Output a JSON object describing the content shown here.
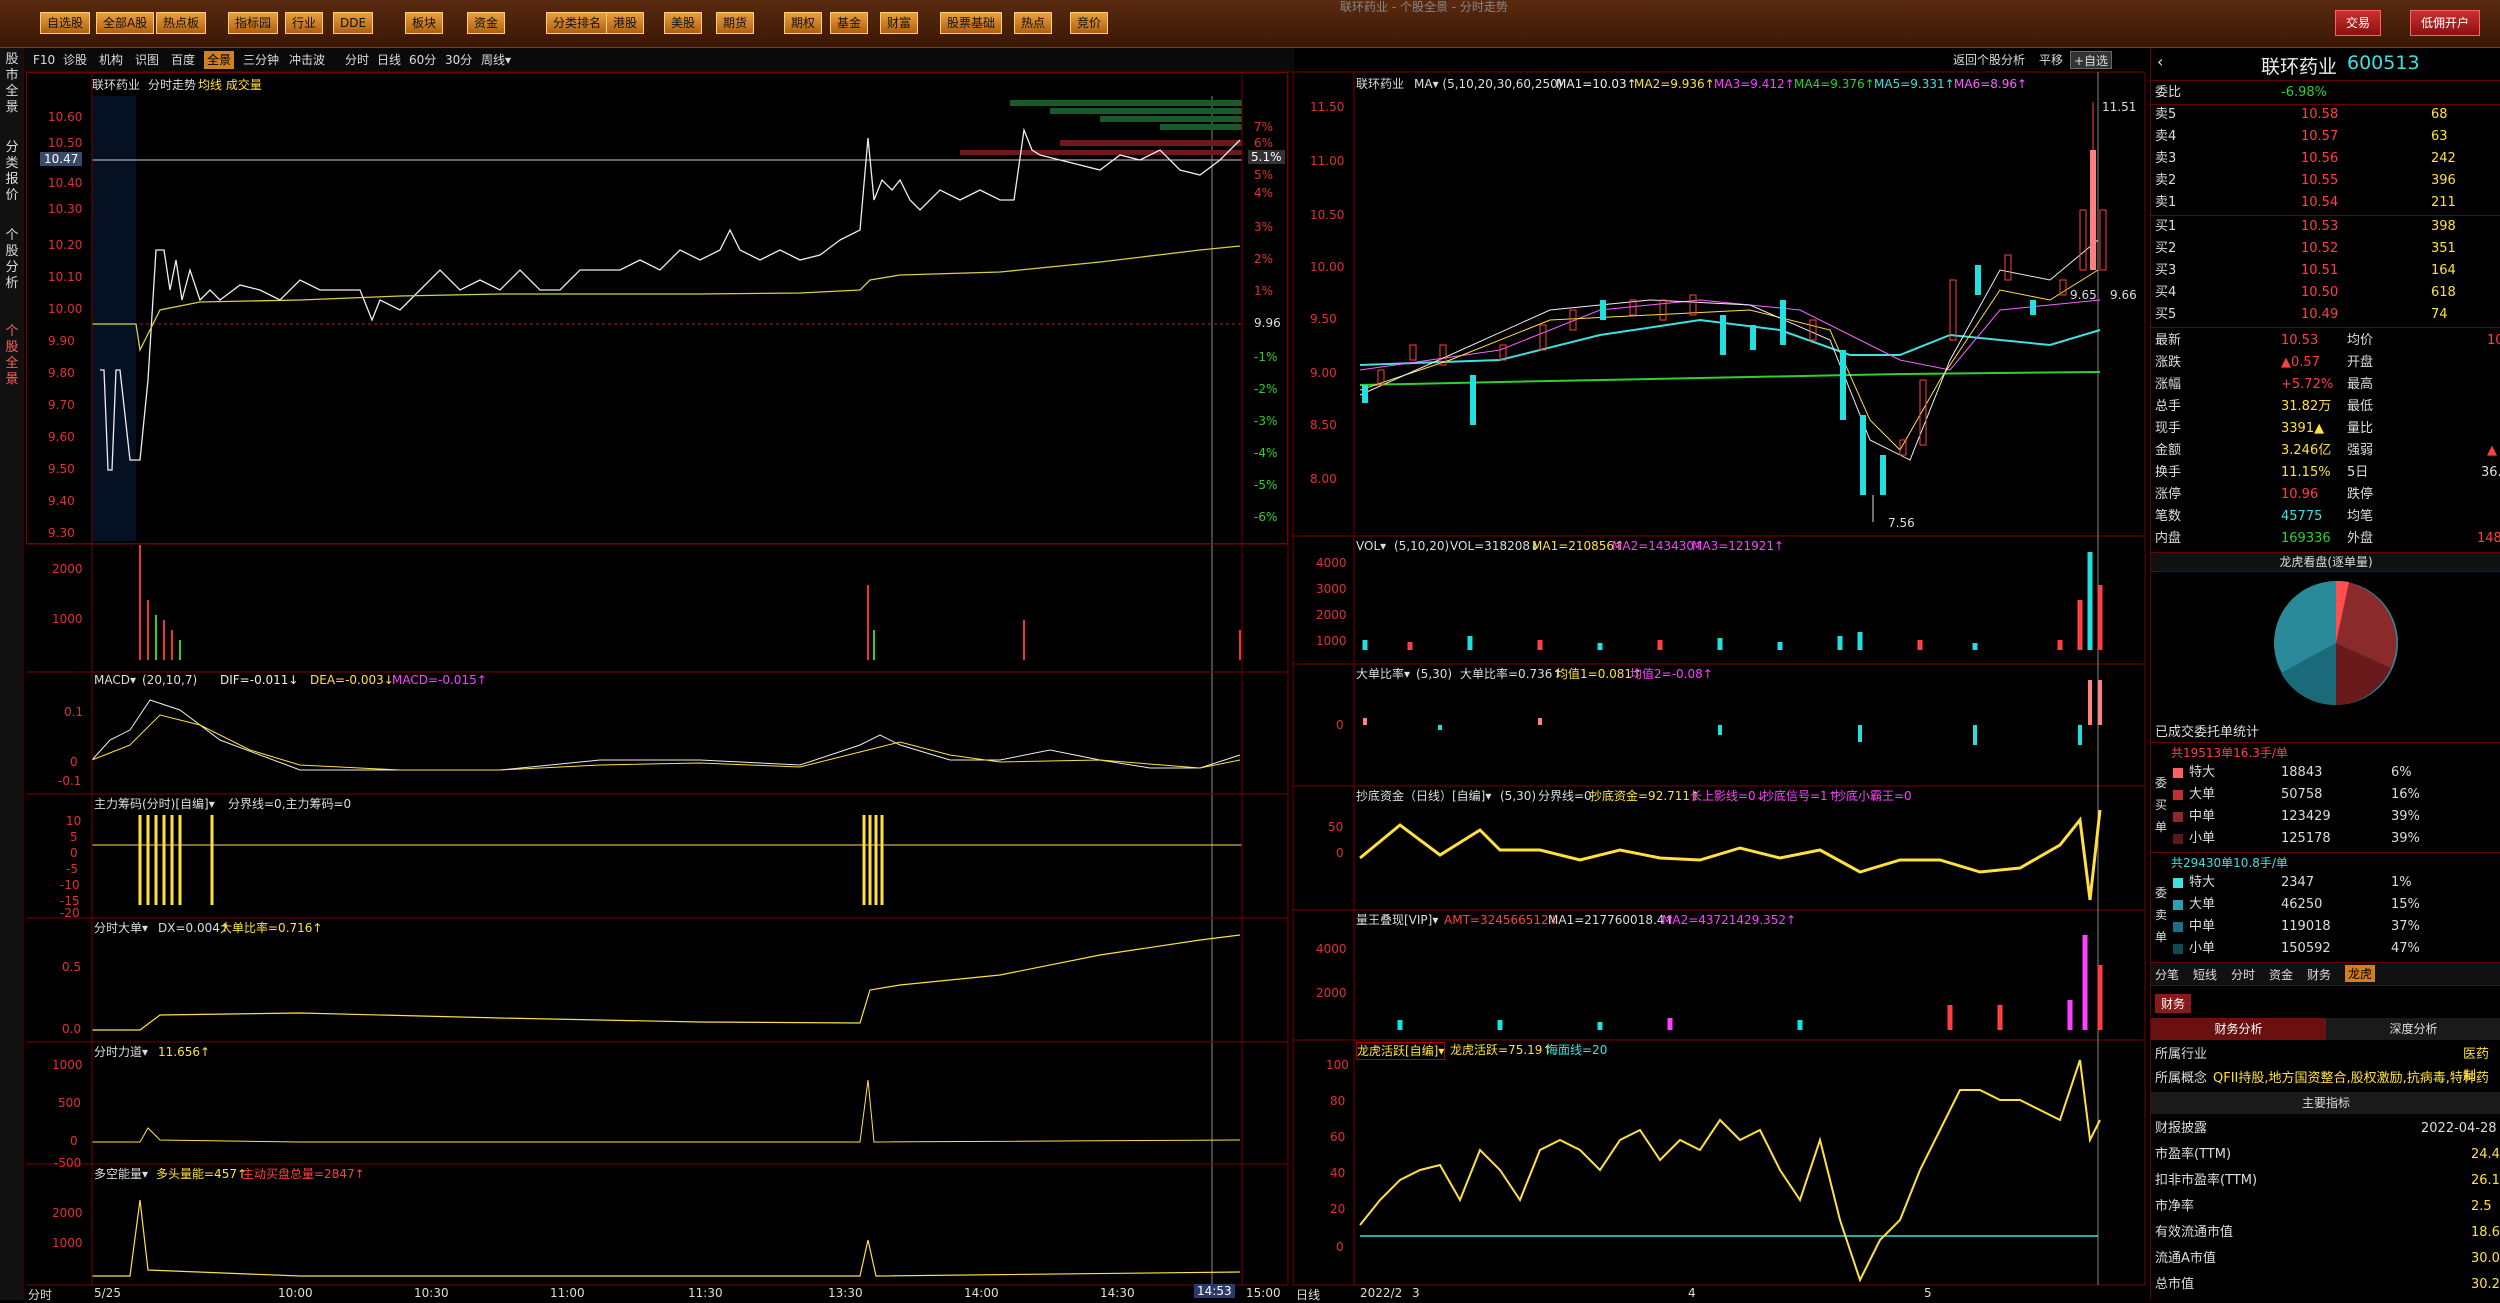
{
  "topbar": {
    "buttons": [
      "自选股",
      "全部A股",
      "热点板",
      "指标园",
      "行业",
      "DDE",
      "板块",
      "资金",
      "分类排名",
      "港股",
      "美股",
      "期货",
      "期权",
      "基金",
      "财富",
      "股票基础",
      "热点",
      "竞价"
    ],
    "title": "联环药业 - 个股全景 - 分时走势",
    "right_buttons": [
      "交易",
      "低佣开户"
    ]
  },
  "leftnav": {
    "tabs": [
      "股市全景",
      "分类报价",
      "个股分析",
      "个股全景"
    ]
  },
  "subtabs": {
    "items": [
      "F10",
      "诊股",
      "机构",
      "识图",
      "百度",
      "全景",
      "三分钟",
      "冲击波",
      "分时",
      "日线",
      "60分",
      "30分",
      "周线▾"
    ],
    "right": [
      "返回个股分析",
      "平移",
      "+自选"
    ]
  },
  "left": {
    "title": {
      "name": "联环药业",
      "mode": "分时走势",
      "indicator": "均线 成交量"
    },
    "price_axis": [
      "10.60",
      "10.50",
      "10.40",
      "10.30",
      "10.20",
      "10.10",
      "10.00",
      "9.90",
      "9.80",
      "9.70",
      "9.60",
      "9.50",
      "9.40",
      "9.30"
    ],
    "current_price": "10.47",
    "pct_axis": [
      "7%",
      "6%",
      "5%",
      "4%",
      "3%",
      "2%",
      "1%",
      "9.96",
      "-1%",
      "-2%",
      "-3%",
      "-4%",
      "-5%",
      "-6%"
    ],
    "current_pct": "5.1%",
    "vol_axis": [
      "2000",
      "1000"
    ],
    "macd": {
      "label": "MACD▾",
      "params": "(20,10,7)",
      "dif": "DIF=-0.011↓",
      "dea": "DEA=-0.003↓",
      "macd": "MACD=-0.015↑",
      "axis": [
        "0.1",
        "0",
        "-0.1"
      ]
    },
    "zlcm": {
      "label": "主力筹码(分时)[自编]▾",
      "text": "分界线=0,主力筹码=0",
      "axis": [
        "10",
        "5",
        "0",
        "-5",
        "-10",
        "-15",
        "-20"
      ]
    },
    "fsdd": {
      "label": "分时大单▾",
      "text": "DX=0.004↑",
      "text2": "大单比率=0.716↑",
      "axis": [
        "0.5",
        "0.0"
      ]
    },
    "fsld": {
      "label": "分时力道▾",
      "text": "11.656↑",
      "axis": [
        "1000",
        "500",
        "0",
        "-500"
      ]
    },
    "dknl": {
      "label": "多空能量▾",
      "text": "多头量能=457↑",
      "text2": "主动买盘总量=2847↑",
      "axis": [
        "2000",
        "1000"
      ]
    },
    "time_axis": [
      "5/25",
      "10:00",
      "10:30",
      "11:00",
      "11:30",
      "13:30",
      "14:00",
      "14:30",
      "15:00"
    ],
    "time_cursor": "14:53",
    "bottom_label": "分时"
  },
  "mid": {
    "title": {
      "name": "联环药业",
      "ma": "MA▾ (5,10,20,30,60,250)",
      "ma1": "MA1=10.03↑",
      "ma2": "MA2=9.936↑",
      "ma3": "MA3=9.412↑",
      "ma4": "MA4=9.376↑",
      "ma5": "MA5=9.331↑",
      "ma6": "MA6=8.96↑"
    },
    "price_axis": [
      "11.50",
      "11.00",
      "10.50",
      "10.00",
      "9.50",
      "9.00",
      "8.50",
      "8.00"
    ],
    "labels": {
      "high": "11.51",
      "low": "7.56",
      "close_l": "9.65",
      "close_r": "9.66"
    },
    "vol": {
      "label": "VOL▾",
      "params": "(5,10,20)",
      "vol": "VOL=318208↓",
      "ma1": "MA1=210856↑",
      "ma2": "MA2=143430↑",
      "ma3": "MA3=121921↑",
      "axis": [
        "4000",
        "3000",
        "2000",
        "1000"
      ]
    },
    "ddbl": {
      "label": "大单比率▾",
      "params": "(5,30)",
      "text": "大单比率=0.736↑",
      "j1": "均值1=0.081↑",
      "j2": "均值2=-0.08↑",
      "axis": [
        "0"
      ]
    },
    "cdzj": {
      "label": "抄底资金（日线）[自编]▾",
      "params": "(5,30)",
      "text": "分界线=0",
      "t2": "抄底资金=92.711↑",
      "t3": "长上影线=0↓",
      "t4": "抄底信号=1↑",
      "t5": "抄底小霸王=0",
      "axis": [
        "50",
        "0"
      ]
    },
    "zzdx": {
      "label": "量王叠现[VIP]▾",
      "amt": "AMT=324566512↓",
      "ma1": "MA1=217760018.4↑",
      "ma2": "MA2=43721429.352↑",
      "axis": [
        "4000",
        "2000"
      ]
    },
    "lhhy": {
      "label": "龙虎活跃[自编]▾",
      "t1": "龙虎活跃=75.19↑",
      "t2": "海面线=20",
      "axis": [
        "100",
        "80",
        "60",
        "40",
        "20",
        "0"
      ]
    },
    "date_axis": [
      "2022/2",
      "3",
      "4",
      "5"
    ],
    "bottom_label": "日线"
  },
  "right": {
    "name": "联环药业",
    "code": "600513",
    "weibi_label": "委比",
    "weibi": "-6.98%",
    "asks": [
      [
        "卖5",
        "10.58",
        "68"
      ],
      [
        "卖4",
        "10.57",
        "63"
      ],
      [
        "卖3",
        "10.56",
        "242"
      ],
      [
        "卖2",
        "10.55",
        "396"
      ],
      [
        "卖1",
        "10.54",
        "211"
      ]
    ],
    "bids": [
      [
        "买1",
        "10.53",
        "398"
      ],
      [
        "买2",
        "10.52",
        "351"
      ],
      [
        "买3",
        "10.51",
        "164"
      ],
      [
        "买4",
        "10.50",
        "618"
      ],
      [
        "买5",
        "10.49",
        "74"
      ]
    ],
    "stats": [
      [
        "最新",
        "10.53",
        "均价",
        "10"
      ],
      [
        "涨跌",
        "▲0.57",
        "开盘",
        ""
      ],
      [
        "涨幅",
        "+5.72%",
        "最高",
        ""
      ],
      [
        "总手",
        "31.82万",
        "最低",
        ""
      ],
      [
        "现手",
        "3391▲",
        "量比",
        ""
      ],
      [
        "金额",
        "3.246亿",
        "强弱",
        "▲"
      ],
      [
        "换手",
        "11.15%",
        "5日",
        "36."
      ],
      [
        "涨停",
        "10.96",
        "跌停",
        ""
      ],
      [
        "笔数",
        "45775",
        "均笔",
        ""
      ],
      [
        "内盘",
        "169336",
        "外盘",
        "148"
      ]
    ],
    "pie_title": "龙虎看盘(逐单量)",
    "order_title": "已成交委托单统计",
    "buy_total": "共19513单16.3手/单",
    "buy": [
      [
        "特大",
        "18843",
        "6%"
      ],
      [
        "大单",
        "50758",
        "16%"
      ],
      [
        "中单",
        "123429",
        "39%"
      ],
      [
        "小单",
        "125178",
        "39%"
      ]
    ],
    "sell_total": "共29430单10.8手/单",
    "sell": [
      [
        "特大",
        "2347",
        "1%"
      ],
      [
        "大单",
        "46250",
        "15%"
      ],
      [
        "中单",
        "119018",
        "37%"
      ],
      [
        "小单",
        "150592",
        "47%"
      ]
    ],
    "side_buy": [
      "委",
      "买",
      "单"
    ],
    "side_sell": [
      "委",
      "卖",
      "单"
    ],
    "tabs": [
      "分笔",
      "短线",
      "分时",
      "资金",
      "财务",
      "龙虎"
    ],
    "fin_tab": "财务",
    "fin_subtabs": [
      "财务分析",
      "深度分析"
    ],
    "industry_label": "所属行业",
    "industry": "医药制",
    "concept_label": "所属概念",
    "concept": "QFII持股,地方国资整合,股权激励,抗病毒,特种药",
    "main_label": "主要指标",
    "fin": [
      [
        "财报披露",
        "2022-04-28"
      ],
      [
        "市盈率(TTM)",
        "24.4"
      ],
      [
        "扣非市盈率(TTM)",
        "26.1"
      ],
      [
        "市净率",
        "2.5"
      ],
      [
        "有效流通市值",
        "18.6"
      ],
      [
        "流通A市值",
        "30.0"
      ],
      [
        "总市值",
        "30.2"
      ]
    ]
  }
}
